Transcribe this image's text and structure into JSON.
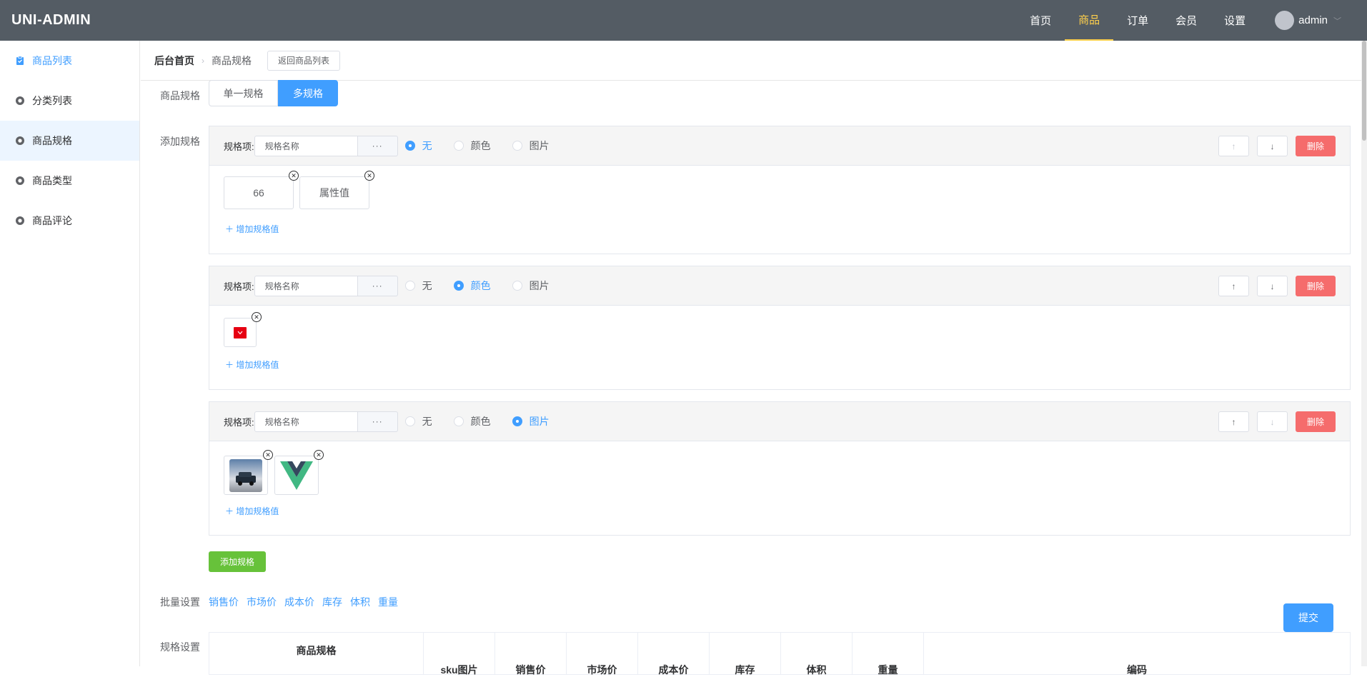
{
  "header": {
    "logo": "UNI-ADMIN",
    "nav": [
      "首页",
      "商品",
      "订单",
      "会员",
      "设置"
    ],
    "active_nav": 1,
    "username": "admin"
  },
  "sidebar": {
    "items": [
      {
        "label": "商品列表",
        "icon": "clipboard-icon"
      },
      {
        "label": "分类列表",
        "icon": "circle-gear-icon"
      },
      {
        "label": "商品规格",
        "icon": "circle-gear-icon"
      },
      {
        "label": "商品类型",
        "icon": "circle-gear-icon"
      },
      {
        "label": "商品评论",
        "icon": "circle-gear-icon"
      }
    ]
  },
  "breadcrumb": {
    "home": "后台首页",
    "current": "商品规格",
    "back_button": "返回商品列表"
  },
  "form": {
    "spec_label": "商品规格",
    "spec_single": "单一规格",
    "spec_multi": "多规格",
    "add_spec_label": "添加规格",
    "item_label": "规格项:",
    "item_placeholder": "规格名称",
    "dots": "···",
    "type_none": "无",
    "type_color": "颜色",
    "type_image": "图片",
    "up": "↑",
    "down": "↓",
    "delete": "删除",
    "add_value": "增加规格值",
    "card1_values": [
      "66",
      "属性值"
    ],
    "add_spec_button": "添加规格",
    "batch_label": "批量设置",
    "batch_links": [
      "销售价",
      "市场价",
      "成本价",
      "库存",
      "体积",
      "重量"
    ],
    "submit": "提交",
    "spec_settings_label": "规格设置",
    "table_headers": [
      "商品规格",
      "sku图片",
      "销售价",
      "市场价",
      "成本价",
      "库存",
      "体积",
      "重量",
      "编码"
    ]
  },
  "colors": {
    "header_bg": "#545c64",
    "active_nav": "#ffd04b",
    "primary": "#409eff",
    "danger": "#f56c6c",
    "success": "#67c23a",
    "swatch_red": "#e60012"
  }
}
